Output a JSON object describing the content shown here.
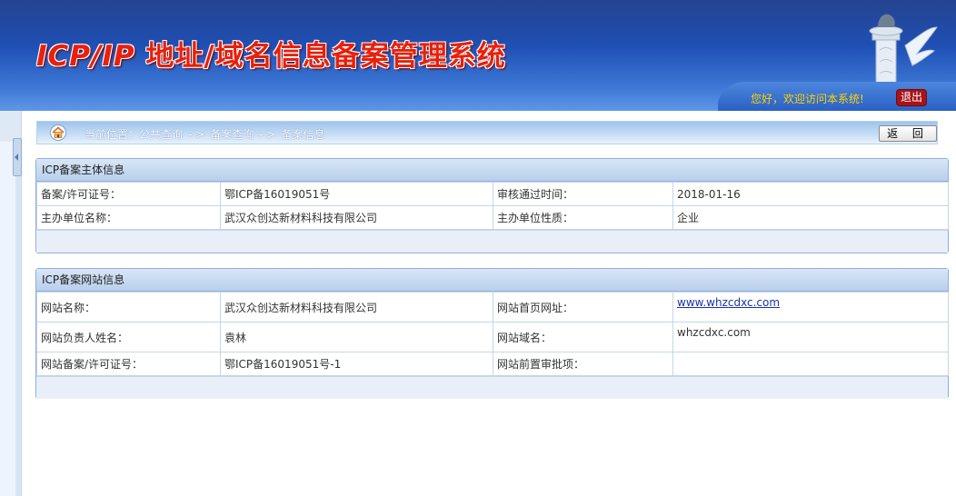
{
  "header": {
    "title_latin": "ICP/IP",
    "title_cjk": " 地址/域名信息备案管理系统",
    "greeting": "您好，欢迎访问本系统!",
    "logout_label": "退出"
  },
  "breadcrumb": {
    "prefix": "当前位置：",
    "items": [
      "公共查询",
      "- >",
      "备案查询",
      "- >",
      "备案信息"
    ],
    "back_label": "返 回"
  },
  "subject_panel": {
    "title": "ICP备案主体信息",
    "rows": [
      {
        "label1": "备案/许可证号：",
        "value1": "鄂ICP备16019051号",
        "label2": "审核通过时间：",
        "value2": "2018-01-16"
      },
      {
        "label1": "主办单位名称：",
        "value1": "武汉众创达新材料科技有限公司",
        "label2": "主办单位性质：",
        "value2": "企业"
      }
    ]
  },
  "site_panel": {
    "title": "ICP备案网站信息",
    "rows": [
      {
        "label1": "网站名称：",
        "value1": "武汉众创达新材料科技有限公司",
        "label2": "网站首页网址：",
        "value2": "www.whzcdxc.com"
      },
      {
        "label1": "网站负责人姓名：",
        "value1": "袁林",
        "label2": "网站域名：",
        "value2": "whzcdxc.com"
      },
      {
        "label1": "网站备案/许可证号：",
        "value1": "鄂ICP备16019051号-1",
        "label2": "网站前置审批项：",
        "value2": ""
      }
    ]
  },
  "colors": {
    "header_dark": "#0d2f85",
    "header_light": "#5f97e6",
    "title_red": "#e8200c",
    "greeting_yellow": "#ffd200",
    "logout_red": "#a6141a",
    "link_blue": "#1a33a6"
  },
  "icons": [
    "pillar-logo-icon",
    "home-icon",
    "collapse-arrow-icon"
  ]
}
